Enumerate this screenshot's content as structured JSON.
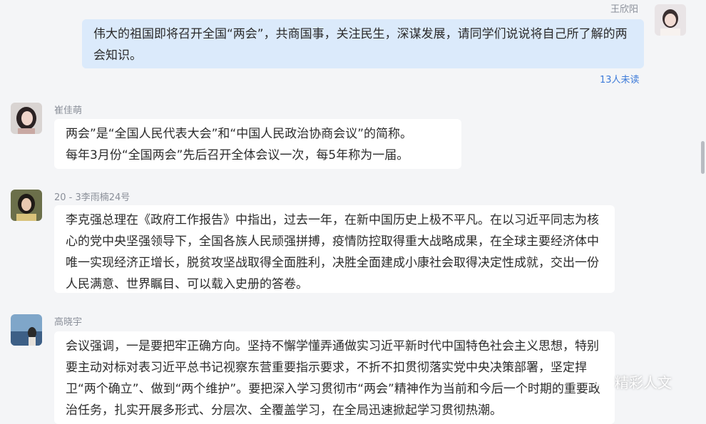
{
  "messages": [
    {
      "sender": "王欣阳",
      "text": "伟大的祖国即将召开全国“两会”，共商国事，关注民生，深谋发展，请同学们说说将自己所了解的两会知识。",
      "read_status": "13人未读"
    },
    {
      "sender": "崔佳萌",
      "text_line1": "两会”是“全国人民代表大会”和“中国人民政治协商会议”的简称。",
      "text_line2": "每年3月份“全国两会”先后召开全体会议一次，每5年称为一届。"
    },
    {
      "sender": "20 - 3李雨楠24号",
      "text": "李克强总理在《政府工作报告》中指出，过去一年，在新中国历史上极不平凡。在以习近平同志为核心的党中央坚强领导下，全国各族人民顽强拼搏，疫情防控取得重大战略成果，在全球主要经济体中唯一实现经济正增长，脱贫攻坚战取得全面胜利，决胜全面建成小康社会取得决定性成就，交出一份人民满意、世界瞩目、可以载入史册的答卷。"
    },
    {
      "sender": "高晓宇",
      "text": "会议强调，一是要把牢正确方向。坚持不懈学懂弄通做实习近平新时代中国特色社会主义思想，特别要主动对标对表习近平总书记视察东营重要指示要求，不折不扣贯彻落实党中央决策部署，坚定捍卫“两个确立”、做到“两个维护”。要把深入学习贯彻市“两会”精神作为当前和今后一个时期的重要政治任务，扎实开展多形式、分层次、全覆盖学习，在全局迅速掀起学习贯彻热潮。"
    }
  ],
  "watermark": {
    "text": "精彩人文",
    "icon": "wechat-icon"
  }
}
